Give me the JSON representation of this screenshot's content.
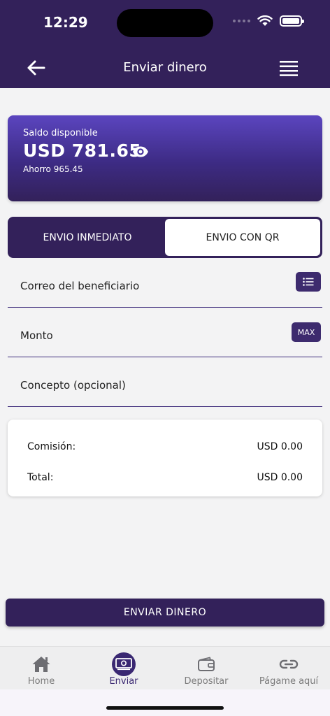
{
  "status": {
    "time": "12:29"
  },
  "header": {
    "title": "Enviar dinero"
  },
  "balance": {
    "label": "Saldo disponible",
    "amount": "USD 781.65",
    "savings": "Ahorro 965.45"
  },
  "tabs": {
    "immediate": "ENVIO INMEDIATO",
    "qr": "ENVIO CON QR",
    "selected": "qr"
  },
  "form": {
    "email_label": "Correo del beneficiario",
    "amount_label": "Monto",
    "max_label": "MAX",
    "concept_label": "Concepto (opcional)"
  },
  "summary": {
    "commission_label": "Comisión:",
    "commission_value": "USD 0.00",
    "total_label": "Total:",
    "total_value": "USD 0.00"
  },
  "actions": {
    "send_label": "ENVIAR DINERO"
  },
  "bottom_nav": {
    "items": [
      {
        "label": "Home",
        "icon": "home-icon"
      },
      {
        "label": "Enviar",
        "icon": "cash-icon",
        "active": true
      },
      {
        "label": "Depositar",
        "icon": "wallet-icon"
      },
      {
        "label": "Págame aquí",
        "icon": "link-icon"
      }
    ]
  },
  "colors": {
    "primary": "#33215a",
    "accent": "#5b45bf",
    "background": "#f3f3f4"
  }
}
